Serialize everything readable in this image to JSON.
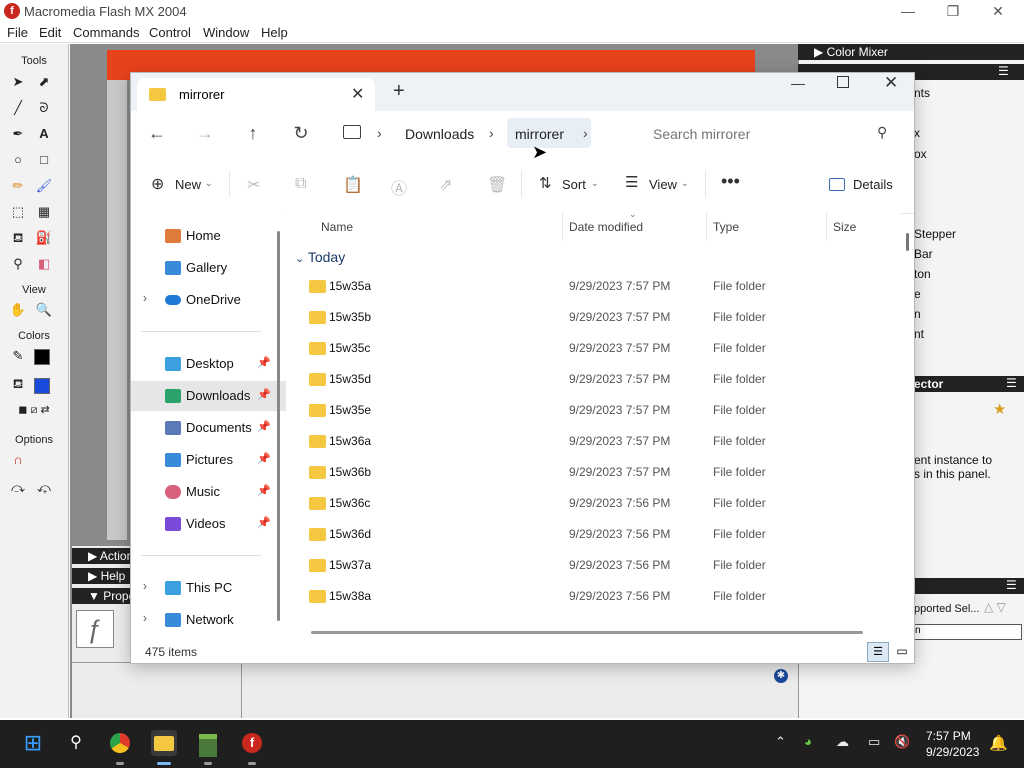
{
  "flash": {
    "title": "Macromedia Flash MX 2004",
    "menus": [
      "File",
      "Edit",
      "Commands",
      "Control",
      "Window",
      "Help"
    ],
    "tools_sections": [
      "Tools",
      "View",
      "Colors",
      "Options"
    ],
    "panels": {
      "color_mixer": "Color Mixer",
      "component_items": [
        "nts",
        "x",
        "ox",
        "Stepper",
        "Bar",
        "ton",
        "e",
        "n",
        "nt"
      ],
      "inspector": "ector",
      "inspector_text_1": "ent instance to",
      "inspector_text_2": "s in this panel.",
      "supported": "pported Sel...",
      "bottom_field": "n"
    },
    "bottom_panels": [
      "Action",
      "Help",
      "Prope"
    ]
  },
  "explorer": {
    "tab_title": "mirrorer",
    "breadcrumb": [
      "Downloads",
      "mirrorer"
    ],
    "search_placeholder": "Search mirrorer",
    "cmd": {
      "new": "New",
      "sort": "Sort",
      "view": "View",
      "details": "Details"
    },
    "nav_items": [
      {
        "label": "Home",
        "color": "#e07a3a"
      },
      {
        "label": "Gallery",
        "color": "#3a8ad9"
      },
      {
        "label": "OneDrive",
        "color": "#1e7ad6"
      }
    ],
    "quick_access": [
      {
        "label": "Desktop",
        "color": "#3aa0e0"
      },
      {
        "label": "Downloads",
        "color": "#2aa36a"
      },
      {
        "label": "Documents",
        "color": "#5a7ab8"
      },
      {
        "label": "Pictures",
        "color": "#3a8ad9"
      },
      {
        "label": "Music",
        "color": "#d9607a"
      },
      {
        "label": "Videos",
        "color": "#7a4ad9"
      }
    ],
    "nav_bottom": [
      {
        "label": "This PC",
        "color": "#3aa0e0"
      },
      {
        "label": "Network",
        "color": "#3a8ad9"
      }
    ],
    "columns": {
      "name": "Name",
      "date": "Date modified",
      "type": "Type",
      "size": "Size"
    },
    "group": "Today",
    "files": [
      {
        "name": "15w35a",
        "date": "9/29/2023 7:57 PM",
        "type": "File folder"
      },
      {
        "name": "15w35b",
        "date": "9/29/2023 7:57 PM",
        "type": "File folder"
      },
      {
        "name": "15w35c",
        "date": "9/29/2023 7:57 PM",
        "type": "File folder"
      },
      {
        "name": "15w35d",
        "date": "9/29/2023 7:57 PM",
        "type": "File folder"
      },
      {
        "name": "15w35e",
        "date": "9/29/2023 7:57 PM",
        "type": "File folder"
      },
      {
        "name": "15w36a",
        "date": "9/29/2023 7:57 PM",
        "type": "File folder"
      },
      {
        "name": "15w36b",
        "date": "9/29/2023 7:57 PM",
        "type": "File folder"
      },
      {
        "name": "15w36c",
        "date": "9/29/2023 7:56 PM",
        "type": "File folder"
      },
      {
        "name": "15w36d",
        "date": "9/29/2023 7:56 PM",
        "type": "File folder"
      },
      {
        "name": "15w37a",
        "date": "9/29/2023 7:56 PM",
        "type": "File folder"
      },
      {
        "name": "15w38a",
        "date": "9/29/2023 7:56 PM",
        "type": "File folder"
      }
    ],
    "status": "475 items"
  },
  "taskbar": {
    "time": "7:57 PM",
    "date": "9/29/2023"
  }
}
